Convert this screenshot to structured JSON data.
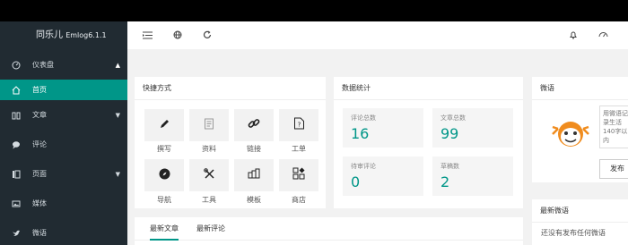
{
  "sidebar": {
    "brand": "同乐儿",
    "version": "Emlog6.1.1",
    "items": [
      {
        "label": "仪表盘",
        "icon": "dashboard-icon",
        "caret": "▲"
      },
      {
        "label": "首页",
        "icon": "home-icon",
        "active": true
      },
      {
        "label": "文章",
        "icon": "article-icon",
        "caret": "▼"
      },
      {
        "label": "评论",
        "icon": "comment-icon"
      },
      {
        "label": "页面",
        "icon": "page-icon",
        "caret": "▼"
      },
      {
        "label": "媒体",
        "icon": "media-icon"
      },
      {
        "label": "微语",
        "icon": "twitter-icon"
      }
    ]
  },
  "topbar": {
    "icons": [
      "menu-toggle-icon",
      "globe-icon",
      "refresh-icon",
      "bell-icon",
      "theme-icon"
    ]
  },
  "shortcuts": {
    "title": "快捷方式",
    "items": [
      {
        "label": "撰写",
        "icon": "pencil-icon"
      },
      {
        "label": "资料",
        "icon": "document-icon"
      },
      {
        "label": "链接",
        "icon": "link-icon"
      },
      {
        "label": "工单",
        "icon": "question-file-icon"
      },
      {
        "label": "导航",
        "icon": "compass-icon"
      },
      {
        "label": "工具",
        "icon": "tools-icon"
      },
      {
        "label": "模板",
        "icon": "template-icon"
      },
      {
        "label": "商店",
        "icon": "store-icon"
      }
    ]
  },
  "stats": {
    "title": "数据统计",
    "items": [
      {
        "label": "评论总数",
        "value": "16"
      },
      {
        "label": "文章总数",
        "value": "99"
      },
      {
        "label": "待审评论",
        "value": "0"
      },
      {
        "label": "草稿数",
        "value": "2"
      }
    ]
  },
  "weiyu": {
    "title": "微语",
    "placeholder": "用微语记录生活 140字以内",
    "publish": "发布"
  },
  "recent_weiyu": {
    "title": "最新微语",
    "empty": "还没有发布任何微语"
  },
  "tabs": {
    "items": [
      "最新文章",
      "最新评论"
    ]
  }
}
